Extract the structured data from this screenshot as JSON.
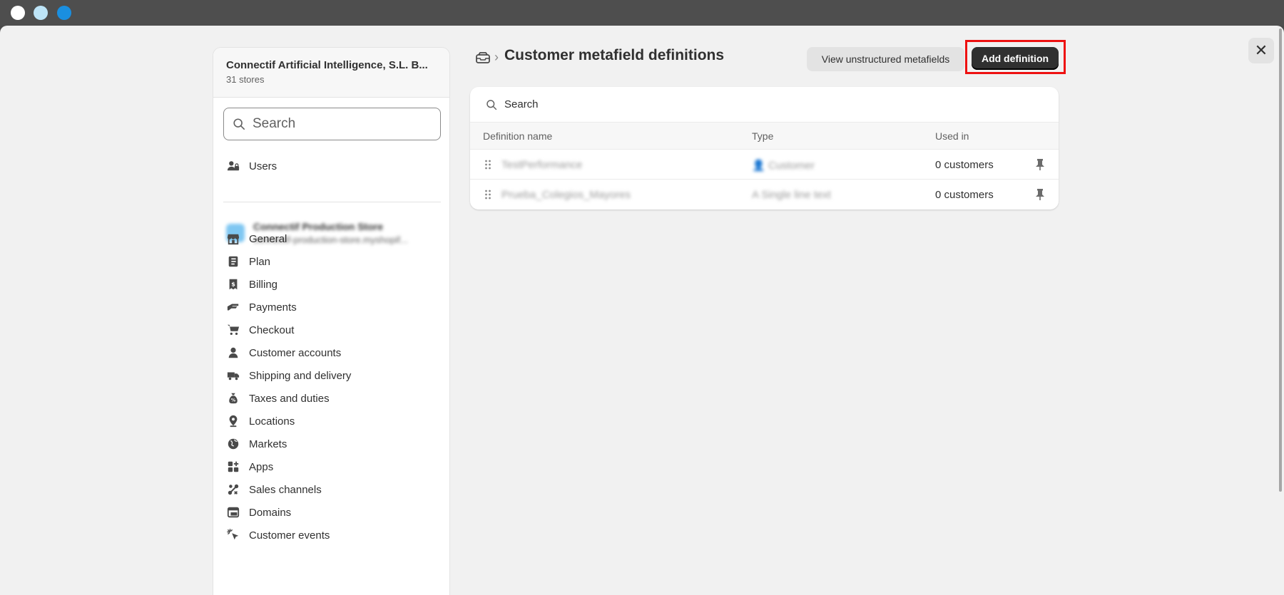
{
  "org": {
    "name": "Connectif Artificial Intelligence, S.L. B...",
    "stores": "31 stores"
  },
  "sidebar": {
    "search_placeholder": "Search",
    "users_label": "Users",
    "store": {
      "name": "Connectif Production Store",
      "url": "connectif-production-store.myshopif..."
    },
    "items": [
      {
        "label": "General",
        "icon": "store-icon"
      },
      {
        "label": "Plan",
        "icon": "plan-icon"
      },
      {
        "label": "Billing",
        "icon": "billing-icon"
      },
      {
        "label": "Payments",
        "icon": "payments-icon"
      },
      {
        "label": "Checkout",
        "icon": "cart-icon"
      },
      {
        "label": "Customer accounts",
        "icon": "person-icon"
      },
      {
        "label": "Shipping and delivery",
        "icon": "truck-icon"
      },
      {
        "label": "Taxes and duties",
        "icon": "money-bag-icon"
      },
      {
        "label": "Locations",
        "icon": "location-icon"
      },
      {
        "label": "Markets",
        "icon": "globe-icon"
      },
      {
        "label": "Apps",
        "icon": "apps-icon"
      },
      {
        "label": "Sales channels",
        "icon": "sales-channels-icon"
      },
      {
        "label": "Domains",
        "icon": "domains-icon"
      },
      {
        "label": "Customer events",
        "icon": "cursor-icon"
      }
    ]
  },
  "header": {
    "title": "Customer metafield definitions",
    "view_unstructured_label": "View unstructured metafields",
    "add_definition_label": "Add definition"
  },
  "table": {
    "search_placeholder": "Search",
    "columns": [
      "Definition name",
      "Type",
      "Used in"
    ],
    "rows": [
      {
        "name": "TestPerformance",
        "type": "Customer",
        "used_in": "0 customers"
      },
      {
        "name": "Prueba_Colegios_Mayores",
        "type": "Single line text",
        "used_in": "0 customers"
      }
    ]
  },
  "colors": {
    "primary_button": "#303030",
    "highlight": "#ee1111",
    "background": "#f1f1f1"
  }
}
